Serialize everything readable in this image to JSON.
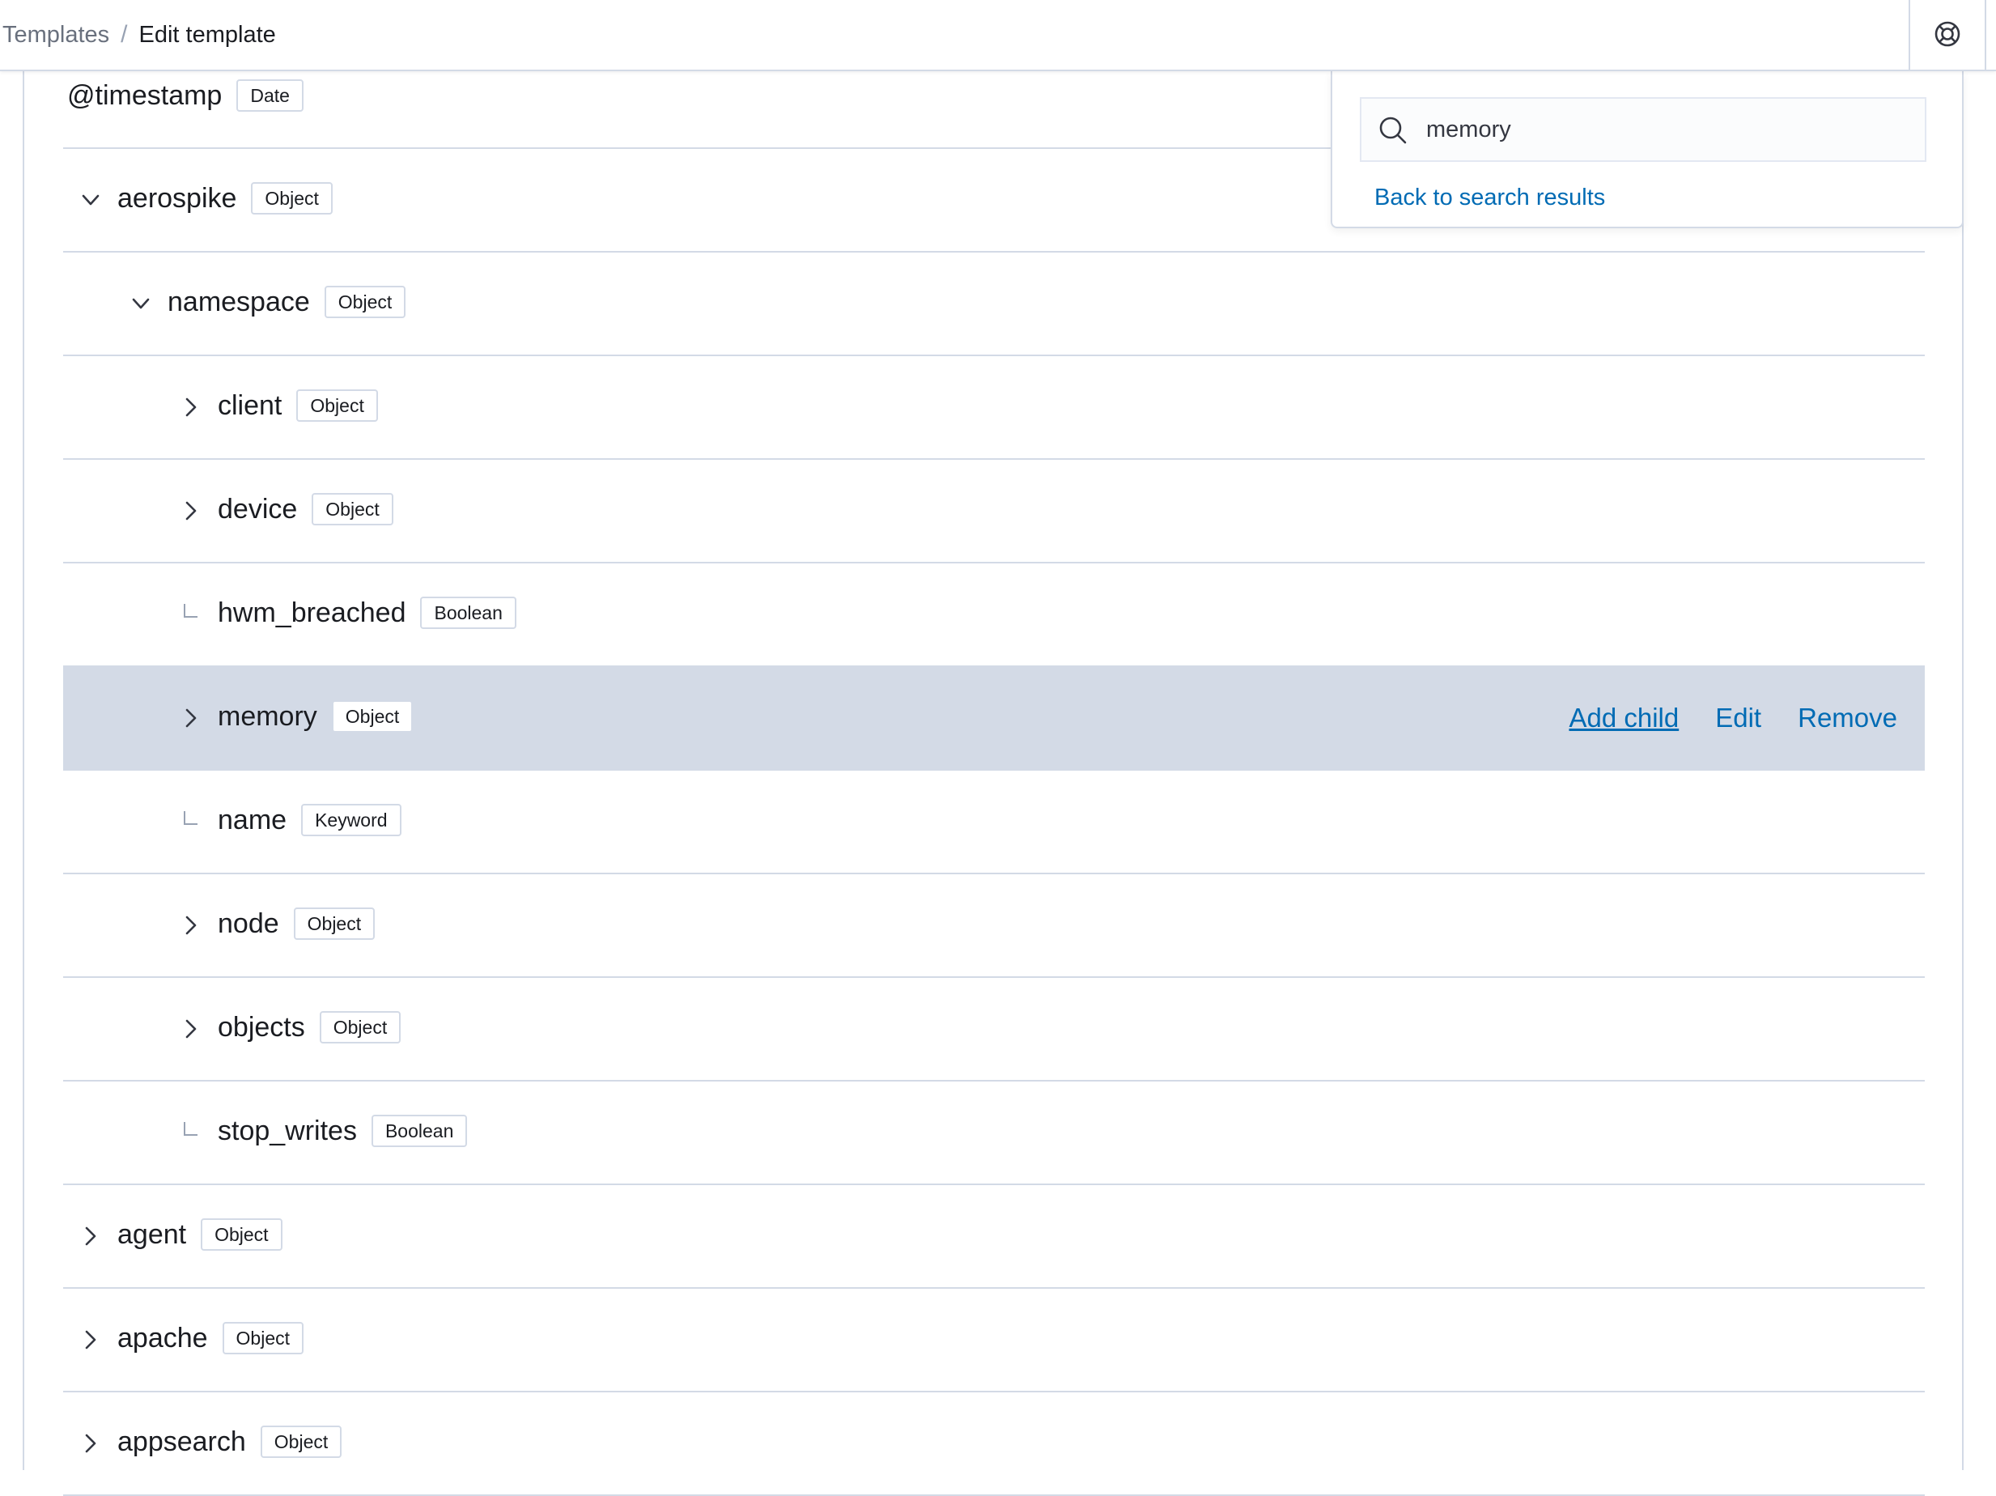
{
  "breadcrumb": {
    "parent": "Templates",
    "separator": "/",
    "current": "Edit template"
  },
  "header": {
    "help_icon": "lifebuoy-icon"
  },
  "search": {
    "value": "memory",
    "placeholder": "",
    "back_link": "Back to search results"
  },
  "rows": [
    {
      "name": "@timestamp",
      "type": "Date",
      "toggle": "none",
      "level": 0
    },
    {
      "name": "aerospike",
      "type": "Object",
      "toggle": "expanded",
      "level": 1
    },
    {
      "name": "namespace",
      "type": "Object",
      "toggle": "expanded",
      "level": 2
    },
    {
      "name": "client",
      "type": "Object",
      "toggle": "collapsed",
      "level": 3
    },
    {
      "name": "device",
      "type": "Object",
      "toggle": "collapsed",
      "level": 3
    },
    {
      "name": "hwm_breached",
      "type": "Boolean",
      "toggle": "leaf",
      "level": 3
    },
    {
      "name": "memory",
      "type": "Object",
      "toggle": "collapsed",
      "level": 3,
      "selected": true
    },
    {
      "name": "name",
      "type": "Keyword",
      "toggle": "leaf",
      "level": 3
    },
    {
      "name": "node",
      "type": "Object",
      "toggle": "collapsed",
      "level": 3
    },
    {
      "name": "objects",
      "type": "Object",
      "toggle": "collapsed",
      "level": 3
    },
    {
      "name": "stop_writes",
      "type": "Boolean",
      "toggle": "leaf",
      "level": 3
    },
    {
      "name": "agent",
      "type": "Object",
      "toggle": "collapsed",
      "level": 1
    },
    {
      "name": "apache",
      "type": "Object",
      "toggle": "collapsed",
      "level": 1
    },
    {
      "name": "appsearch",
      "type": "Object",
      "toggle": "collapsed",
      "level": 1
    }
  ],
  "row_actions": {
    "add_child": "Add child",
    "edit": "Edit",
    "remove": "Remove"
  },
  "colors": {
    "link": "#006bb4",
    "selected_row": "#d3dae6",
    "border": "#d3dae6",
    "text": "#1a1c21"
  }
}
